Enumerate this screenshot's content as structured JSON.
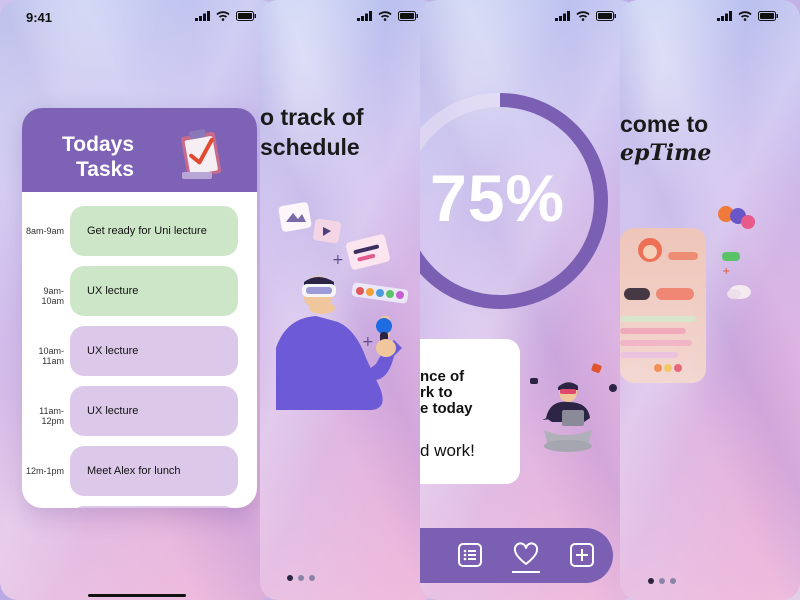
{
  "status": {
    "time": "9:41"
  },
  "screen1": {
    "title_line1": "Todays",
    "title_line2": "Tasks",
    "tasks": [
      {
        "time": "8am-9am",
        "label": "Get ready for Uni lecture",
        "color": "green"
      },
      {
        "time": "9am-10am",
        "label": "UX lecture",
        "color": "green"
      },
      {
        "time": "10am-11am",
        "label": "UX lecture",
        "color": "purple"
      },
      {
        "time": "11am-12pm",
        "label": "UX lecture",
        "color": "purple"
      },
      {
        "time": "12m-1pm",
        "label": "Meet Alex for lunch",
        "color": "purple"
      }
    ]
  },
  "screen2": {
    "heading_line1": "o track of",
    "heading_line2": "schedule"
  },
  "screen3": {
    "progress_text": "75%",
    "progress_value": 0.75,
    "message_line1": "nce of",
    "message_line2": "rk to",
    "message_line3": "e today",
    "message_line4": "d work!",
    "tabs": [
      {
        "icon": "list-icon"
      },
      {
        "icon": "heart-icon",
        "active": true
      },
      {
        "icon": "plus-square-icon"
      }
    ]
  },
  "screen4": {
    "heading": "come to",
    "brand": "epTime"
  },
  "colors": {
    "accent": "#7e62b6",
    "task_green": "#cde6c8",
    "task_purple": "#dcc9ea"
  }
}
